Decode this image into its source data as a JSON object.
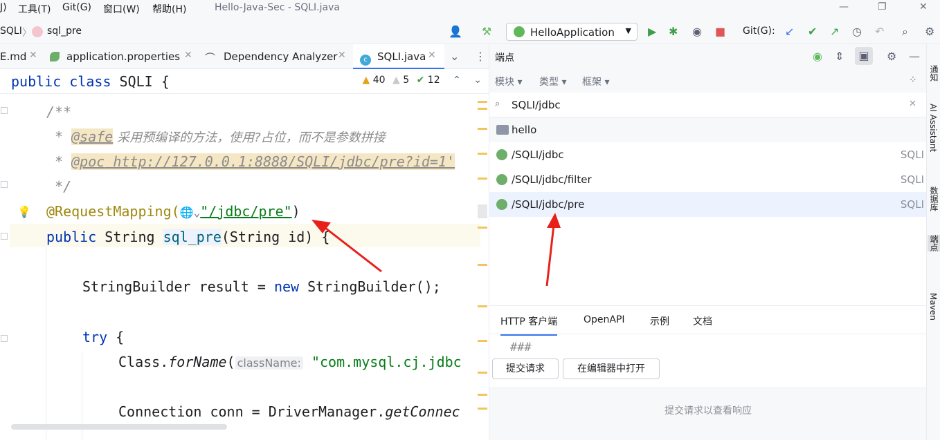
{
  "menu": {
    "items": [
      "J)",
      "工具(T)",
      "Git(G)",
      "窗口(W)",
      "帮助(H)"
    ],
    "window_title": "Hello-Java-Sec - SQLI.java"
  },
  "nav": {
    "crumbs": [
      "SQLI",
      "sql_pre"
    ],
    "run_config": "HelloApplication",
    "git_label": "Git(G):"
  },
  "tabs": [
    {
      "label": "E.md"
    },
    {
      "label": "application.properties"
    },
    {
      "label": "Dependency Analyzer"
    },
    {
      "label": "SQLI.java"
    }
  ],
  "editor": {
    "header_line": "public class SQLI {",
    "warnings": "40",
    "weak_warnings": "5",
    "typos": "12",
    "lines": {
      "l1": "/**",
      "l2_star": "*",
      "l2_tag": "@safe",
      "l2_text": " 采用预编译的方法，使用?占位，而不是参数拼接",
      "l3_star": "*",
      "l3_tag": "@poc",
      "l3_text": " http://127.0.0.1:8888/SQLI/jdbc/pre?id=1'",
      "l4": "*/",
      "l5_ann": "@RequestMapping(",
      "l5_str": "\"/jdbc/pre\"",
      "l5_end": ")",
      "l6_kw": "public",
      "l6_type": " String ",
      "l6_fn": "sql_pre",
      "l6_rest": "(String id) {",
      "l7": "StringBuilder result = ",
      "l7_kw": "new",
      "l7_end": " StringBuilder();",
      "l8_kw": "try",
      "l8_end": " {",
      "l9_a": "Class.",
      "l9_b": "forName",
      "l9_c": "(",
      "l9_hint": "className:",
      "l9_str": " \"com.mysql.cj.jdbc",
      "l10_a": "Connection conn = DriverManager.",
      "l10_b": "getConnec"
    }
  },
  "endpoints": {
    "title": "端点",
    "filters": [
      "模块",
      "类型",
      "框架"
    ],
    "search": "SQLI/jdbc",
    "group": "hello",
    "rows": [
      {
        "path": "/SQLI/jdbc",
        "module": "SQLI"
      },
      {
        "path": "/SQLI/jdbc/filter",
        "module": "SQLI"
      },
      {
        "path": "/SQLI/jdbc/pre",
        "module": "SQLI"
      }
    ],
    "http_tabs": [
      "HTTP 客户端",
      "OpenAPI",
      "示例",
      "文档"
    ],
    "request_text": "###",
    "submit_button": "提交请求",
    "open_editor_button": "在编辑器中打开",
    "response_placeholder": "提交请求以查看响应"
  },
  "stripe": [
    "通知",
    "AI Assistant",
    "数据库",
    "端点",
    "Maven"
  ],
  "colors": {
    "arrow": "#e8201a",
    "accent": "#3574f0"
  }
}
